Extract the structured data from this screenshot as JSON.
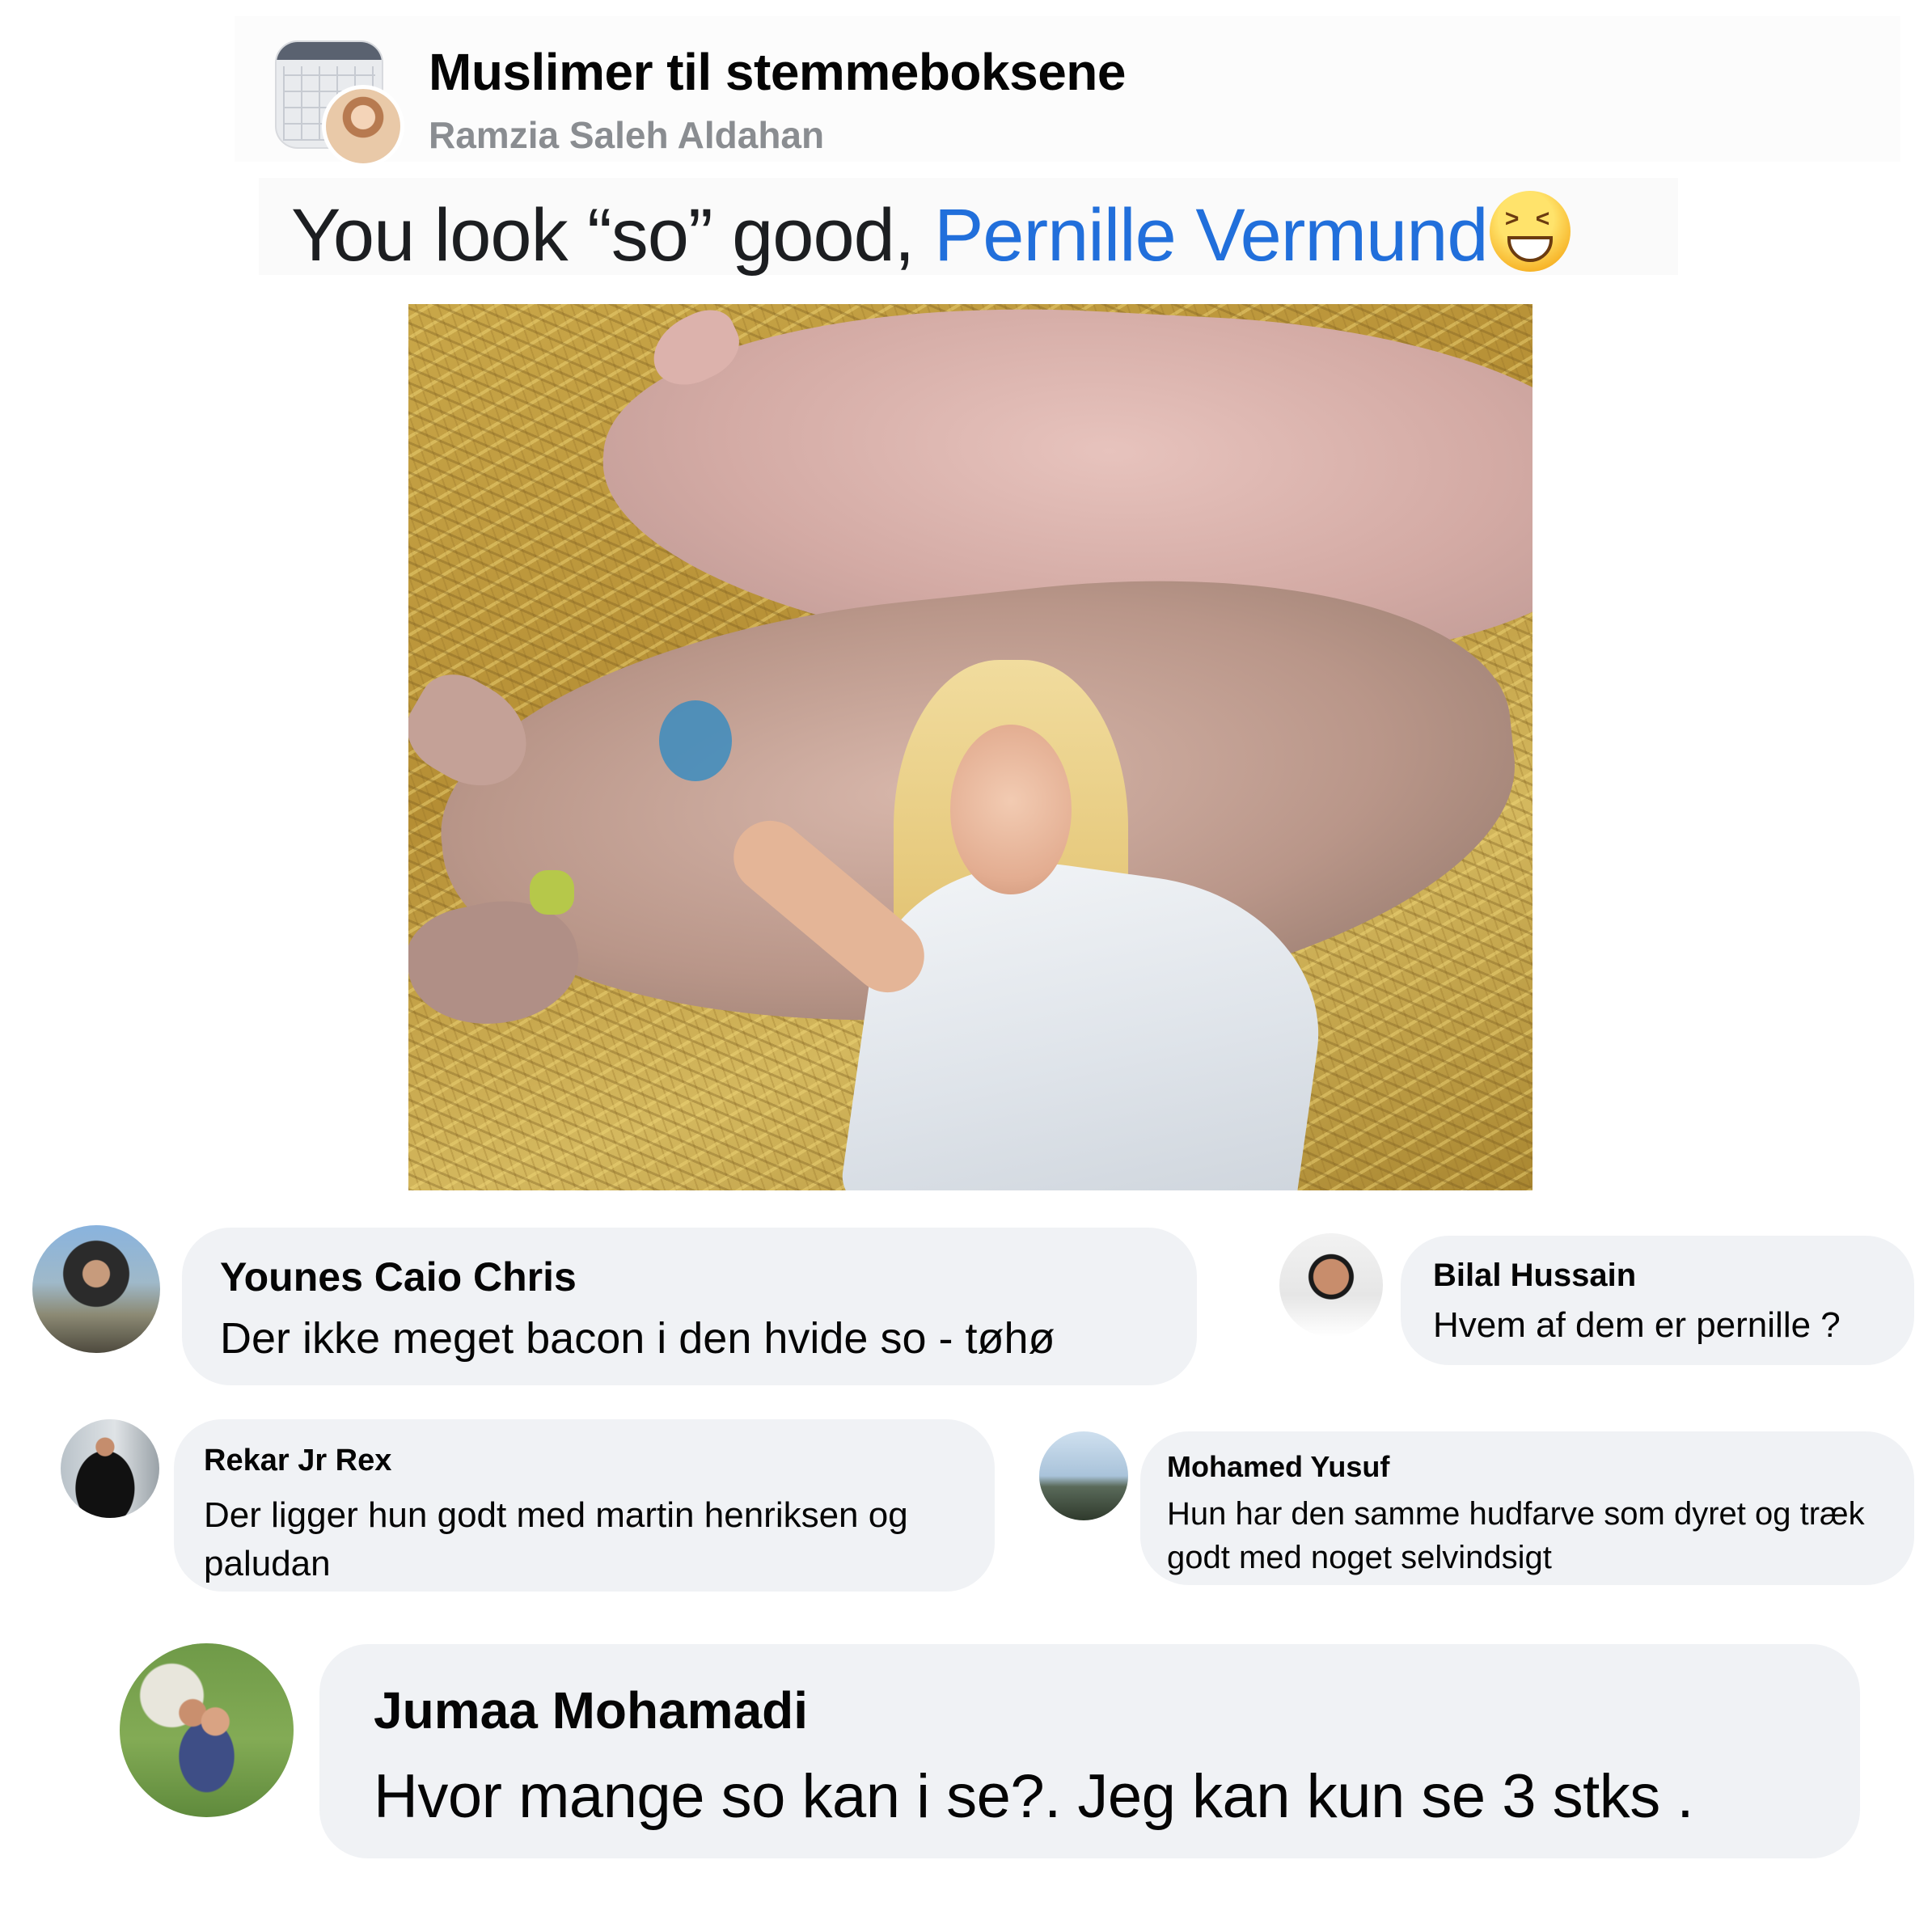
{
  "post": {
    "group_name": "Muslimer til stemmeboksene",
    "author": "Ramzia Saleh Aldahan",
    "text_prefix": "You look “so” good, ",
    "mention": "Pernille Vermund",
    "emoji": "grinning-squinting-face"
  },
  "comments": [
    {
      "name": "Younes Caio Chris",
      "text": "Der ikke meget bacon i den hvide so - tøhø"
    },
    {
      "name": "Bilal Hussain",
      "text": "Hvem af dem er pernille ?"
    },
    {
      "name": "Rekar Jr Rex",
      "text": "Der ligger hun godt med martin henriksen og paludan"
    },
    {
      "name": "Mohamed Yusuf",
      "text": "Hun har den samme hudfarve som dyret og træk godt med noget selvindsigt"
    },
    {
      "name": "Jumaa Mohamadi",
      "text": "Hvor mange so kan i se?. Jeg kan kun se 3 stks ."
    }
  ],
  "colors": {
    "mention": "#216fdb",
    "bubble": "#f0f2f5",
    "secondary_text": "#8a8d91"
  }
}
